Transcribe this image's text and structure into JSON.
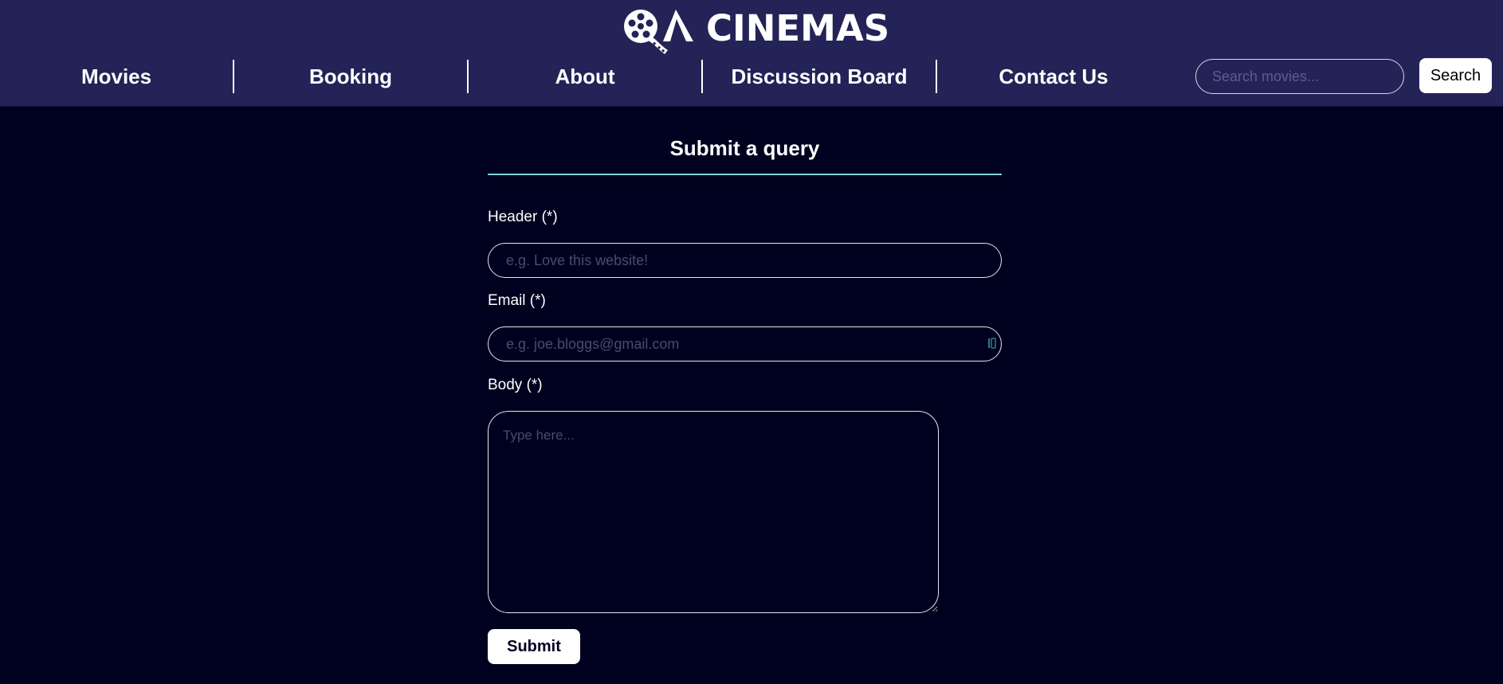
{
  "brand": {
    "logo_text": "CINEMAS",
    "logo_icon": "film-reel-qa-logo",
    "header_bg": "#232357",
    "page_bg": "#00001f",
    "accent": "#7fd3dd"
  },
  "nav": {
    "items": [
      {
        "label": "Movies"
      },
      {
        "label": "Booking"
      },
      {
        "label": "About"
      },
      {
        "label": "Discussion Board"
      },
      {
        "label": "Contact Us"
      }
    ]
  },
  "search": {
    "placeholder": "Search movies...",
    "value": "",
    "button_label": "Search"
  },
  "form": {
    "title": "Submit a query",
    "header_field": {
      "label": "Header (*)",
      "placeholder": "e.g. Love this website!",
      "value": ""
    },
    "email_field": {
      "label": "Email (*)",
      "placeholder": "e.g. joe.bloggs@gmail.com",
      "value": "",
      "addon_icon": "password-manager-icon"
    },
    "body_field": {
      "label": "Body (*)",
      "placeholder": "Type here...",
      "value": ""
    },
    "submit_label": "Submit"
  }
}
